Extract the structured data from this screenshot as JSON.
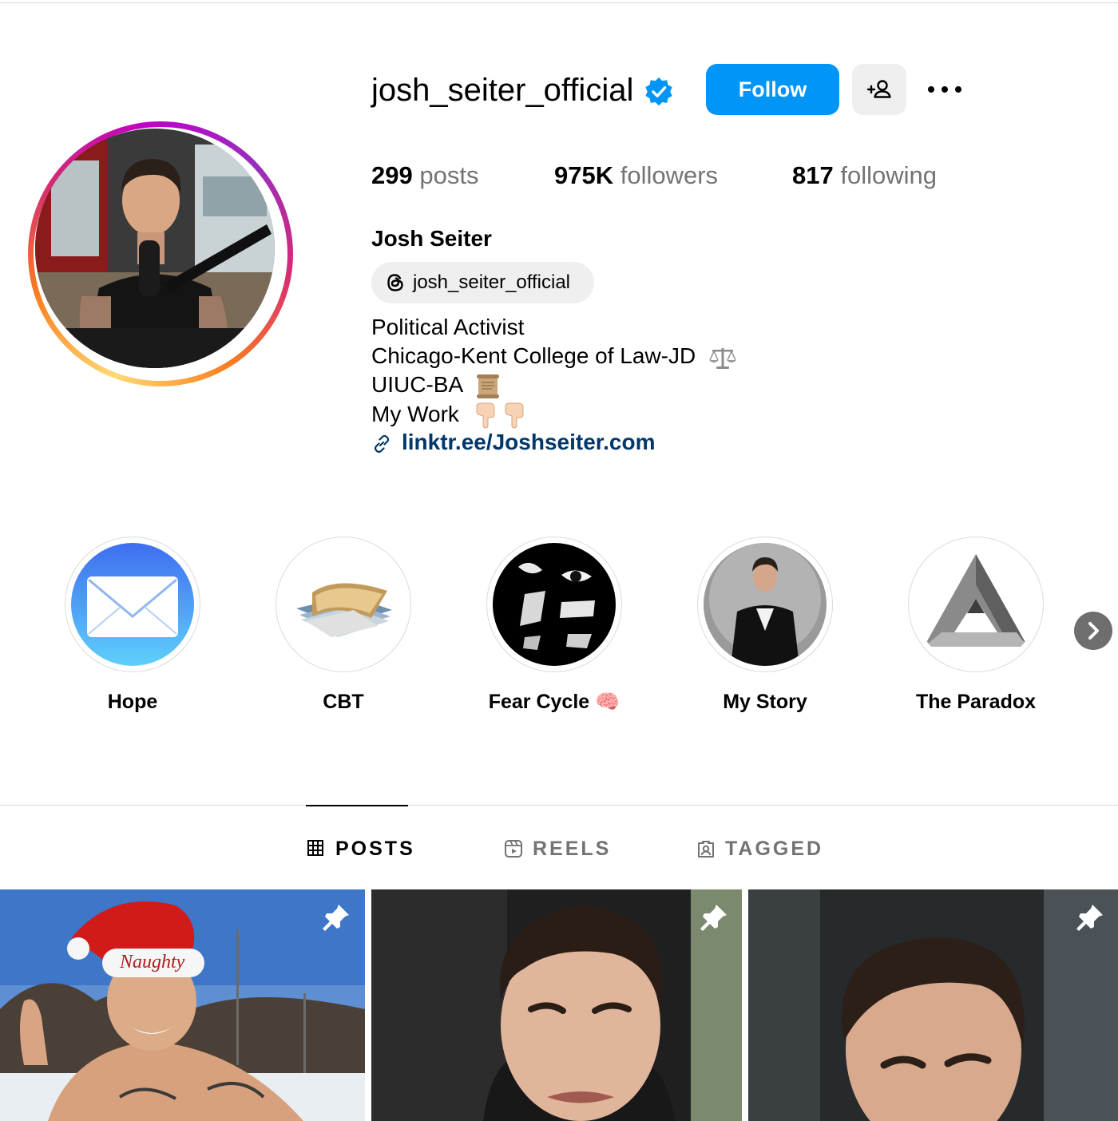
{
  "profile": {
    "username": "josh_seiter_official",
    "verified": true,
    "follow_label": "Follow",
    "stats": [
      {
        "count": "299",
        "label": "posts"
      },
      {
        "count": "975K",
        "label": "followers"
      },
      {
        "count": "817",
        "label": "following"
      }
    ],
    "full_name": "Josh Seiter",
    "threads_handle": "josh_seiter_official",
    "bio": {
      "line1": "Political Activist",
      "line2": "Chicago-Kent College of Law-JD",
      "line3": "UIUC-BA",
      "line4": "My Work"
    },
    "link": "linktr.ee/Joshseiter.com"
  },
  "highlights": [
    {
      "label": "Hope",
      "icon": "mail-envelope"
    },
    {
      "label": "CBT",
      "icon": "stacked-photos"
    },
    {
      "label": "Fear Cycle 🧠",
      "icon": "dark-eyes"
    },
    {
      "label": "My Story",
      "icon": "man-in-suit"
    },
    {
      "label": "The Paradox",
      "icon": "impossible-triangle"
    }
  ],
  "tabs": [
    {
      "label": "POSTS",
      "icon": "grid-icon",
      "active": true
    },
    {
      "label": "REELS",
      "icon": "reels-icon",
      "active": false
    },
    {
      "label": "TAGGED",
      "icon": "tagged-icon",
      "active": false
    }
  ],
  "posts": [
    {
      "pinned": true,
      "hat_text": "Naughty"
    },
    {
      "pinned": true
    },
    {
      "pinned": true
    }
  ],
  "colors": {
    "follow_blue": "#0095f6",
    "link_blue": "#00376b",
    "muted_gray": "#737373",
    "border_gray": "#dbdbdb",
    "button_gray": "#efefef"
  }
}
